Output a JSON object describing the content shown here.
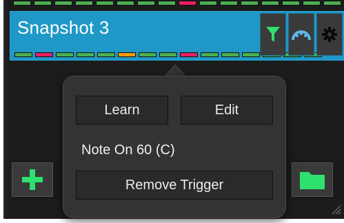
{
  "snapshot": {
    "title": "Snapshot 3",
    "top_leds": [
      "green",
      "green",
      "green",
      "green",
      "green",
      "green",
      "green",
      "green",
      "pink",
      "green",
      "green",
      "green",
      "green",
      "green",
      "green",
      "green"
    ],
    "leds": [
      "green",
      "pink",
      "green",
      "green",
      "green",
      "orange",
      "green",
      "green",
      "pink",
      "green",
      "green",
      "green",
      "green",
      "green",
      "green"
    ]
  },
  "card_buttons": [
    {
      "name": "filter-button",
      "icon": "funnel-icon"
    },
    {
      "name": "midi-button",
      "icon": "gauge-icon"
    },
    {
      "name": "settings-button",
      "icon": "gear-icon"
    }
  ],
  "bottom_bar": {
    "add_icon": "plus-icon",
    "folder_icon": "folder-icon"
  },
  "popover": {
    "learn_label": "Learn",
    "edit_label": "Edit",
    "trigger_text": "Note On 60 (C)",
    "remove_label": "Remove Trigger"
  },
  "colors": {
    "accent": "#1f98c7",
    "led_green": "#4caf50",
    "led_pink": "#e91e63",
    "led_orange": "#ff9800",
    "icon_green": "#2ee06e",
    "icon_blue": "#5fb8e8"
  }
}
